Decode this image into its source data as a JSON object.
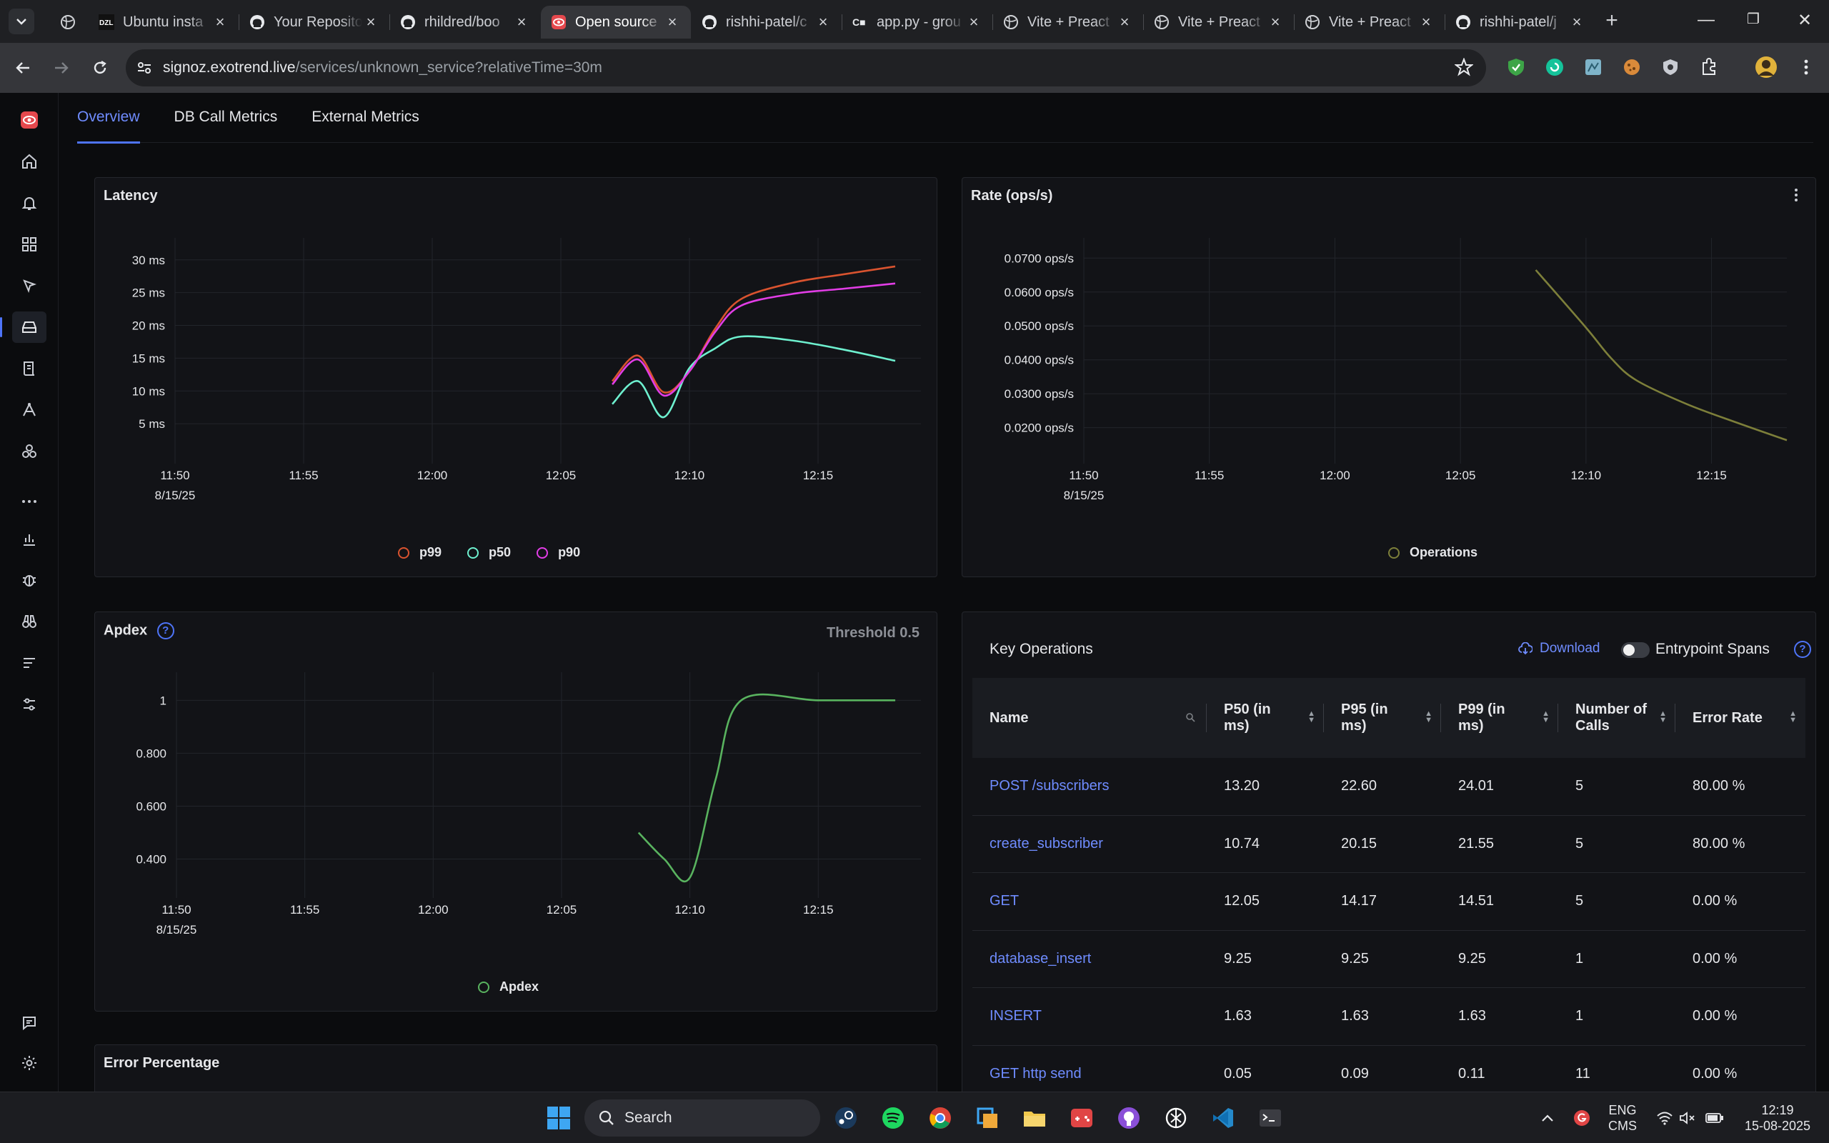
{
  "browser": {
    "tabs": [
      {
        "title": "Ubuntu insta",
        "icon": "dzl-favicon",
        "active": false
      },
      {
        "title": "Your Reposito",
        "icon": "github-icon",
        "active": false
      },
      {
        "title": "rhildred/boo",
        "icon": "github-icon",
        "active": false
      },
      {
        "title": "Open source",
        "icon": "signoz-icon",
        "active": true
      },
      {
        "title": "rishhi-patel/c",
        "icon": "github-icon",
        "active": false
      },
      {
        "title": "app.py - grou",
        "icon": "codeium-icon",
        "active": false
      },
      {
        "title": "Vite + Preact",
        "icon": "globe-icon",
        "active": false
      },
      {
        "title": "Vite + Preact",
        "icon": "globe-icon",
        "active": false
      },
      {
        "title": "Vite + Preact",
        "icon": "globe-icon",
        "active": false
      },
      {
        "title": "rishhi-patel/j",
        "icon": "github-icon",
        "active": false
      }
    ],
    "url_host": "signoz.exotrend.live",
    "url_path": "/services/unknown_service?relativeTime=30m"
  },
  "subtabs": [
    "Overview",
    "DB Call Metrics",
    "External Metrics"
  ],
  "latency": {
    "title": "Latency",
    "legend": [
      "p99",
      "p50",
      "p90"
    ]
  },
  "rate": {
    "title": "Rate (ops/s)",
    "legend": [
      "Operations"
    ]
  },
  "apdex": {
    "title": "Apdex",
    "threshold": "Threshold 0.5",
    "legend": [
      "Apdex"
    ]
  },
  "error_pct": {
    "title": "Error Percentage"
  },
  "key_ops": {
    "title": "Key Operations",
    "download": "Download",
    "entrypoint": "Entrypoint Spans",
    "columns": [
      "Name",
      "P50 (in ms)",
      "P95 (in ms)",
      "P99 (in ms)",
      "Number of Calls",
      "Error Rate"
    ],
    "rows": [
      {
        "name": "POST /subscribers",
        "p50": "13.20",
        "p95": "22.60",
        "p99": "24.01",
        "calls": "5",
        "err": "80.00 %"
      },
      {
        "name": "create_subscriber",
        "p50": "10.74",
        "p95": "20.15",
        "p99": "21.55",
        "calls": "5",
        "err": "80.00 %"
      },
      {
        "name": "GET",
        "p50": "12.05",
        "p95": "14.17",
        "p99": "14.51",
        "calls": "5",
        "err": "0.00 %"
      },
      {
        "name": "database_insert",
        "p50": "9.25",
        "p95": "9.25",
        "p99": "9.25",
        "calls": "1",
        "err": "0.00 %"
      },
      {
        "name": "INSERT",
        "p50": "1.63",
        "p95": "1.63",
        "p99": "1.63",
        "calls": "1",
        "err": "0.00 %"
      },
      {
        "name": "GET http send",
        "p50": "0.05",
        "p95": "0.09",
        "p99": "0.11",
        "calls": "11",
        "err": "0.00 %"
      }
    ]
  },
  "chart_data": [
    {
      "type": "line",
      "title": "Latency",
      "x_ticks": [
        "11:50",
        "11:55",
        "12:00",
        "12:05",
        "12:10",
        "12:15"
      ],
      "x_date": "8/15/25",
      "y_ticks": [
        "30 ms",
        "25 ms",
        "20 ms",
        "15 ms",
        "10 ms",
        "5 ms"
      ],
      "ylim": [
        0,
        32
      ],
      "colors": {
        "p99": "#d9532f",
        "p50": "#6ef0cf",
        "p90": "#e23de6"
      },
      "series": [
        {
          "name": "p99",
          "x": [
            "12:07",
            "12:08",
            "12:09",
            "12:10",
            "12:11",
            "12:12",
            "12:14",
            "12:16",
            "12:18"
          ],
          "values": [
            11.5,
            15.4,
            9.8,
            13.0,
            19.5,
            24.0,
            26.5,
            27.8,
            29.0
          ]
        },
        {
          "name": "p50",
          "x": [
            "12:07",
            "12:08",
            "12:09",
            "12:10",
            "12:11",
            "12:12",
            "12:14",
            "12:16",
            "12:18"
          ],
          "values": [
            8.0,
            11.5,
            6.0,
            13.5,
            16.5,
            18.3,
            17.7,
            16.3,
            14.6
          ]
        },
        {
          "name": "p90",
          "x": [
            "12:07",
            "12:08",
            "12:09",
            "12:10",
            "12:11",
            "12:12",
            "12:14",
            "12:16",
            "12:18"
          ],
          "values": [
            11.0,
            14.8,
            9.3,
            13.0,
            19.0,
            23.0,
            24.8,
            25.6,
            26.4
          ]
        }
      ]
    },
    {
      "type": "line",
      "title": "Rate (ops/s)",
      "x_ticks": [
        "11:50",
        "11:55",
        "12:00",
        "12:05",
        "12:10",
        "12:15"
      ],
      "x_date": "8/15/25",
      "y_ticks": [
        "0.0700 ops/s",
        "0.0600 ops/s",
        "0.0500 ops/s",
        "0.0400 ops/s",
        "0.0300 ops/s",
        "0.0200 ops/s"
      ],
      "colors": {
        "Operations": "#7d7f3a"
      },
      "series": [
        {
          "name": "Operations",
          "x": [
            "12:08",
            "12:10",
            "12:11",
            "12:12",
            "12:14",
            "12:16",
            "12:18"
          ],
          "values": [
            0.0665,
            0.0495,
            0.0405,
            0.034,
            0.027,
            0.0215,
            0.0163
          ]
        }
      ]
    },
    {
      "type": "line",
      "title": "Apdex",
      "x_ticks": [
        "11:50",
        "11:55",
        "12:00",
        "12:05",
        "12:10",
        "12:15"
      ],
      "x_date": "8/15/25",
      "y_ticks": [
        "1",
        "0.800",
        "0.600",
        "0.400"
      ],
      "colors": {
        "Apdex": "#59b35f"
      },
      "series": [
        {
          "name": "Apdex",
          "x": [
            "12:08",
            "12:09",
            "12:10",
            "12:11",
            "12:12",
            "12:15",
            "12:18"
          ],
          "values": [
            0.5,
            0.4,
            0.33,
            0.7,
            1.0,
            1.0,
            1.0
          ]
        }
      ]
    }
  ],
  "taskbar": {
    "search": "Search",
    "lang1": "ENG",
    "lang2": "CMS",
    "time": "12:19",
    "date": "15-08-2025"
  }
}
